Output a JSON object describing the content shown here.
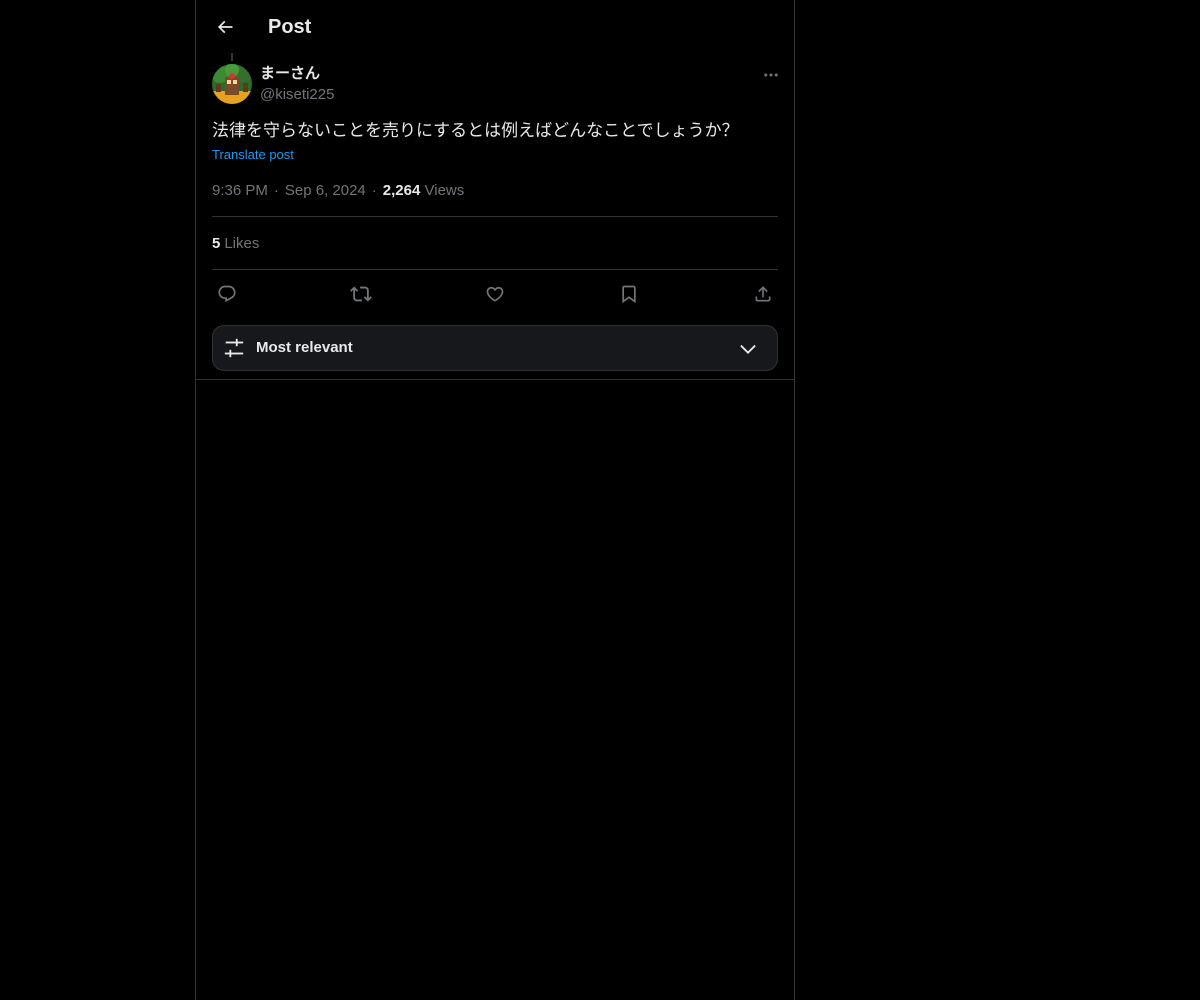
{
  "header": {
    "title": "Post"
  },
  "post": {
    "author": {
      "display_name": "まーさん",
      "handle": "@kiseti225"
    },
    "text": "法律を守らないことを売りにするとは例えばどんなことでしょうか？",
    "translate_label": "Translate post",
    "time": "9:36 PM",
    "date": "Sep 6, 2024",
    "views_count": "2,264",
    "views_label": "Views",
    "separator": "·",
    "likes_count": "5",
    "likes_label": "Likes"
  },
  "actions": {
    "reply_icon": "reply-icon",
    "repost_icon": "repost-icon",
    "like_icon": "heart-icon",
    "bookmark_icon": "bookmark-icon",
    "share_icon": "share-icon"
  },
  "sort": {
    "label": "Most relevant"
  },
  "colors": {
    "background": "#000000",
    "text": "#e7e9ea",
    "secondary": "#71767b",
    "link": "#1d9bf0",
    "border": "#2f3336"
  }
}
